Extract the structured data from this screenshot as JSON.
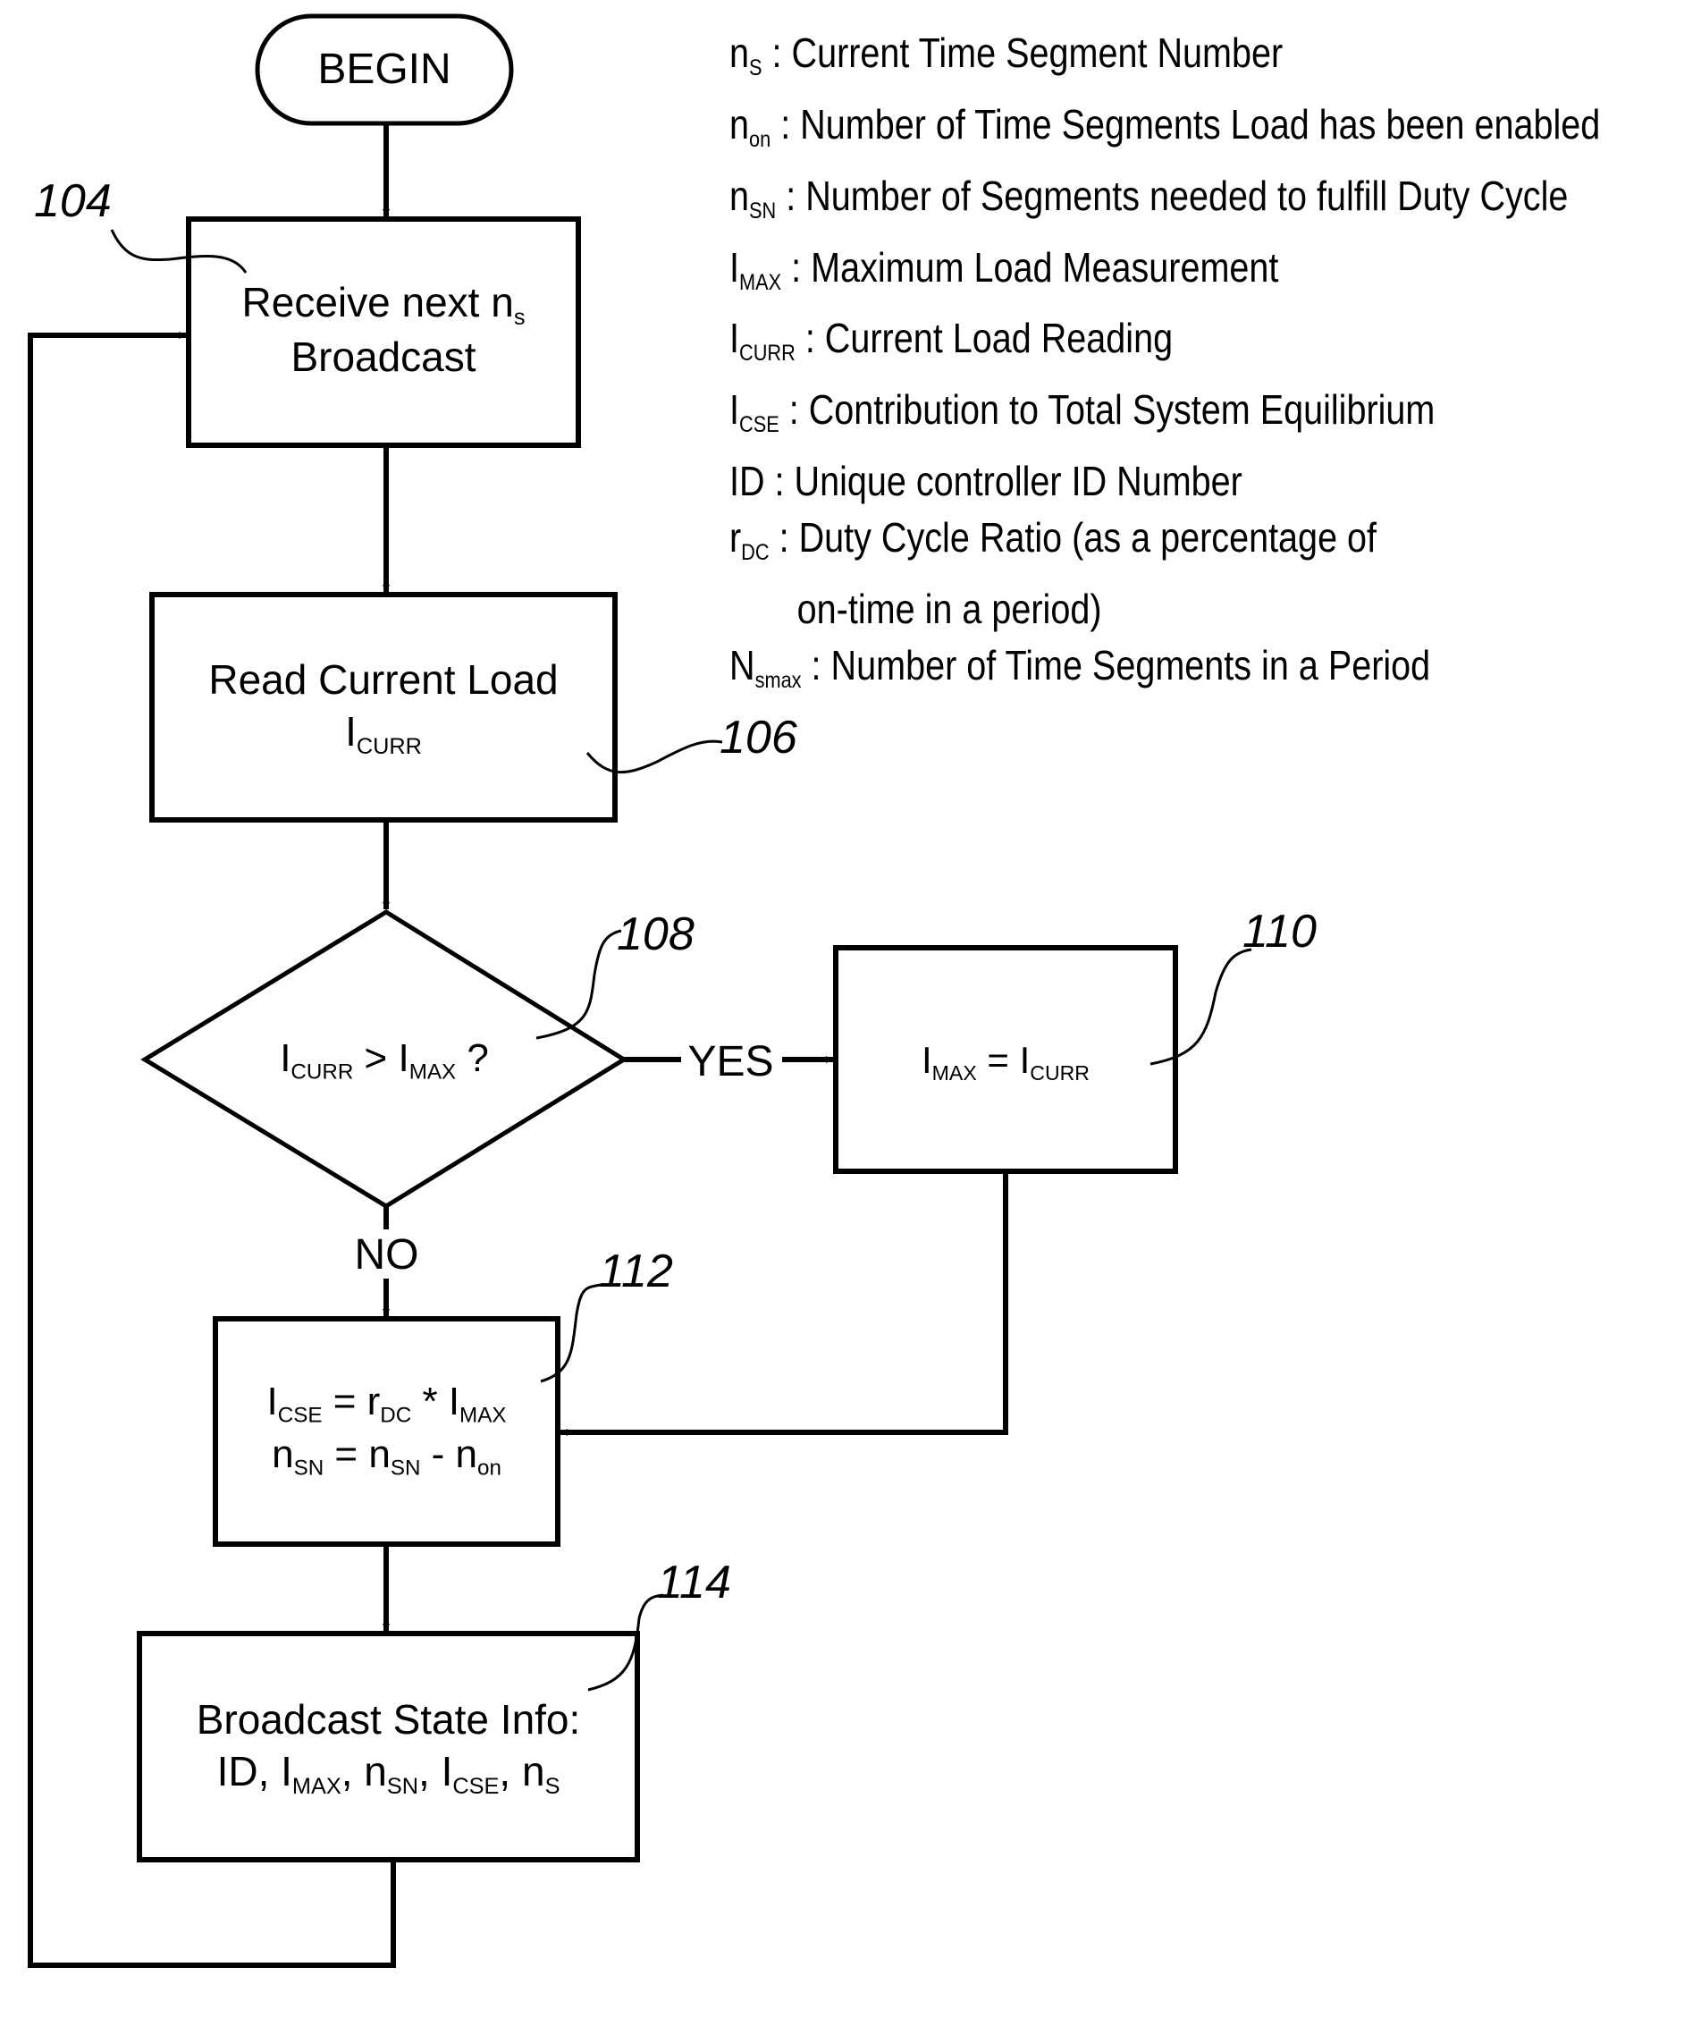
{
  "figure": {
    "nodes": {
      "begin": {
        "label": "BEGIN"
      },
      "n104": {
        "ref": "104",
        "line1_pre": "Receive next n",
        "line1_sub": "s",
        "line2": "Broadcast"
      },
      "n106": {
        "ref": "106",
        "line1": "Read Current Load",
        "var": "I",
        "var_sub": "CURR"
      },
      "n108": {
        "ref": "108",
        "a": "I",
        "a_sub": "CURR",
        "op": " > ",
        "b": "I",
        "b_sub": "MAX",
        "q": " ?"
      },
      "n110": {
        "ref": "110",
        "a": "I",
        "a_sub": "MAX",
        "op": " = ",
        "b": "I",
        "b_sub": "CURR"
      },
      "n112": {
        "ref": "112",
        "eq1": {
          "l": "I",
          "l_sub": "CSE",
          "op1": " = ",
          "r1": "r",
          "r1_sub": "DC",
          "op2": " * ",
          "r2": "I",
          "r2_sub": "MAX"
        },
        "eq2": {
          "l": "n",
          "l_sub": "SN",
          "op1": " = ",
          "r1": "n",
          "r1_sub": "SN",
          "op2": " - ",
          "r2": "n",
          "r2_sub": "on"
        }
      },
      "n114": {
        "ref": "114",
        "line1": "Broadcast State Info:",
        "items": [
          {
            "base": "ID",
            "sub": ""
          },
          {
            "base": ", I",
            "sub": "MAX"
          },
          {
            "base": ", n",
            "sub": "SN"
          },
          {
            "base": ", I",
            "sub": "CSE"
          },
          {
            "base": ", n",
            "sub": "S"
          }
        ]
      }
    },
    "edges": {
      "yes_label": "YES",
      "no_label": "NO"
    },
    "legend": [
      {
        "sym": "n",
        "sub": "S",
        "desc": " : Current Time Segment Number"
      },
      {
        "sym": "n",
        "sub": "on",
        "desc": " : Number of Time Segments Load has been enabled"
      },
      {
        "sym": "n",
        "sub": "SN",
        "desc": " : Number of Segments needed to fulfill Duty Cycle"
      },
      {
        "sym": "I",
        "sub": "MAX",
        "desc": " : Maximum Load Measurement"
      },
      {
        "sym": "I",
        "sub": "CURR",
        "desc": " : Current Load Reading"
      },
      {
        "sym": "I",
        "sub": "CSE",
        "desc": " : Contribution to Total System Equilibrium"
      },
      {
        "sym": "ID",
        "sub": "",
        "desc": " : Unique controller ID Number"
      },
      {
        "sym": "r",
        "sub": "DC",
        "desc": " : Duty Cycle Ratio (as a percentage of"
      },
      {
        "sym": "",
        "sub": "",
        "desc": "on-time in a period)",
        "indent": true
      },
      {
        "sym": "N",
        "sub": "smax",
        "desc": " : Number of Time Segments in a Period"
      }
    ]
  }
}
